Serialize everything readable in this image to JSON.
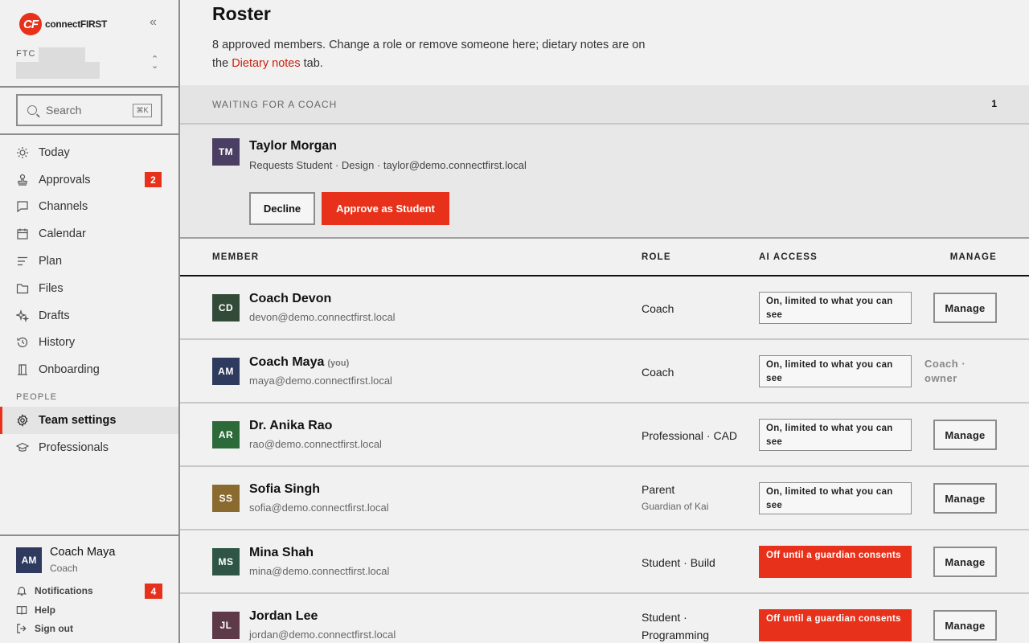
{
  "sidebar": {
    "brand": {
      "mark": "CF",
      "name_plain": "connect",
      "name_bold": "FIRST"
    },
    "collapse_icon": "double-chevron-left",
    "team_code": "FTC",
    "search": {
      "placeholder": "Search",
      "shortcut": "⌘K"
    },
    "nav": [
      {
        "label": "Today",
        "icon": "sun-icon"
      },
      {
        "label": "Approvals",
        "icon": "stamp-icon",
        "badge": "2"
      },
      {
        "label": "Channels",
        "icon": "chat-icon"
      },
      {
        "label": "Calendar",
        "icon": "calendar-icon"
      },
      {
        "label": "Plan",
        "icon": "list-icon"
      },
      {
        "label": "Files",
        "icon": "folder-icon"
      },
      {
        "label": "Drafts",
        "icon": "sparkle-icon"
      },
      {
        "label": "History",
        "icon": "history-icon"
      },
      {
        "label": "Onboarding",
        "icon": "door-icon"
      }
    ],
    "people_section": "PEOPLE",
    "people_nav": [
      {
        "label": "Team settings",
        "icon": "gear-icon",
        "active": true
      },
      {
        "label": "Professionals",
        "icon": "graduation-cap-icon"
      }
    ],
    "user": {
      "initials": "AM",
      "name": "Coach Maya",
      "role": "Coach"
    },
    "footer": {
      "notifications": "Notifications",
      "notifications_badge": "4",
      "help": "Help",
      "sign_out": "Sign out"
    }
  },
  "main": {
    "title": "Roster",
    "intro_before": "8 approved members. Change a role or remove someone here; dietary notes are on the ",
    "intro_link": "Dietary notes",
    "intro_after": " tab.",
    "waiting": {
      "label": "WAITING FOR A COACH",
      "count": "1"
    },
    "pending": {
      "initials": "TM",
      "name": "Taylor Morgan",
      "details": "Requests Student · Design · taylor@demo.connectfirst.local",
      "decline_label": "Decline",
      "approve_label": "Approve as Student"
    },
    "columns": {
      "member": "MEMBER",
      "role": "ROLE",
      "ai_access": "AI ACCESS",
      "manage": "MANAGE"
    },
    "members": [
      {
        "initials": "CD",
        "name": "Coach Devon",
        "email": "devon@demo.connectfirst.local",
        "role": "Coach",
        "ai": "On, limited to what you can see",
        "manage": "Manage"
      },
      {
        "initials": "AM",
        "name": "Coach Maya",
        "you": "(you)",
        "email": "maya@demo.connectfirst.local",
        "role": "Coach",
        "ai": "On, limited to what you can see",
        "owner": "Coach · owner"
      },
      {
        "initials": "AR",
        "name": "Dr. Anika Rao",
        "email": "rao@demo.connectfirst.local",
        "role": "Professional · CAD",
        "ai": "On, limited to what you can see",
        "manage": "Manage"
      },
      {
        "initials": "SS",
        "name": "Sofia Singh",
        "email": "sofia@demo.connectfirst.local",
        "role": "Parent",
        "role_sub": "Guardian of Kai",
        "ai": "On, limited to what you can see",
        "manage": "Manage"
      },
      {
        "initials": "MS",
        "name": "Mina Shah",
        "email": "mina@demo.connectfirst.local",
        "role": "Student · Build",
        "ai": "Off until a guardian consents",
        "manage": "Manage"
      },
      {
        "initials": "JL",
        "name": "Jordan Lee",
        "email": "jordan@demo.connectfirst.local",
        "role": "Student · Programming",
        "ai": "Off until a guardian consents",
        "manage": "Manage"
      }
    ]
  },
  "colors": {
    "accent": "#e8311a",
    "avatar_tm": "#4a3f63",
    "avatar_cd": "#344a38",
    "avatar_am": "#2e3a5e",
    "avatar_ar": "#2c6a3a",
    "avatar_ss": "#8a6a2e",
    "avatar_ms": "#2e5545",
    "avatar_jl": "#5e3a48"
  }
}
